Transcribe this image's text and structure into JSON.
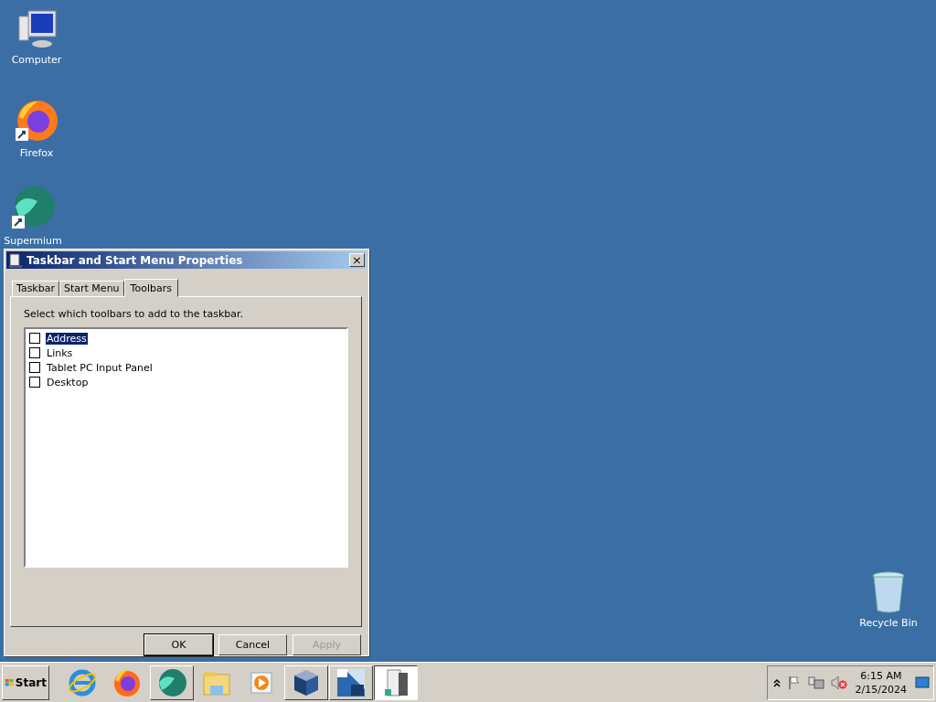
{
  "desktop_icons": [
    {
      "label": "Computer",
      "kind": "computer"
    },
    {
      "label": "Firefox",
      "kind": "firefox"
    },
    {
      "label": "Supermium",
      "kind": "supermium"
    },
    {
      "label": "Recycle Bin",
      "kind": "bin"
    }
  ],
  "dialog": {
    "title": "Taskbar and Start Menu Properties",
    "close": "×",
    "tabs": [
      {
        "label": "Taskbar",
        "selected": false
      },
      {
        "label": "Start Menu",
        "selected": false
      },
      {
        "label": "Toolbars",
        "selected": true
      }
    ],
    "instruction": "Select which toolbars to add to the taskbar.",
    "toolbars": [
      {
        "label": "Address",
        "checked": false,
        "selected": true
      },
      {
        "label": "Links",
        "checked": false,
        "selected": false
      },
      {
        "label": "Tablet PC Input Panel",
        "checked": false,
        "selected": false
      },
      {
        "label": "Desktop",
        "checked": false,
        "selected": false
      }
    ],
    "buttons": [
      {
        "label": "OK",
        "default": true,
        "disabled": false
      },
      {
        "label": "Cancel",
        "default": false,
        "disabled": false
      },
      {
        "label": "Apply",
        "default": false,
        "disabled": true
      }
    ]
  },
  "taskbar": {
    "start": "Start",
    "items": [
      {
        "kind": "ie",
        "open": false,
        "selected": false
      },
      {
        "kind": "firefox",
        "open": false,
        "selected": false
      },
      {
        "kind": "supermium",
        "open": true,
        "selected": false
      },
      {
        "kind": "folder",
        "open": false,
        "selected": false
      },
      {
        "kind": "media",
        "open": false,
        "selected": false
      },
      {
        "kind": "box",
        "open": true,
        "selected": false
      },
      {
        "kind": "app64",
        "open": true,
        "selected": false
      },
      {
        "kind": "server",
        "open": true,
        "selected": true
      }
    ],
    "time": "6:15 AM",
    "date": "2/15/2024"
  }
}
